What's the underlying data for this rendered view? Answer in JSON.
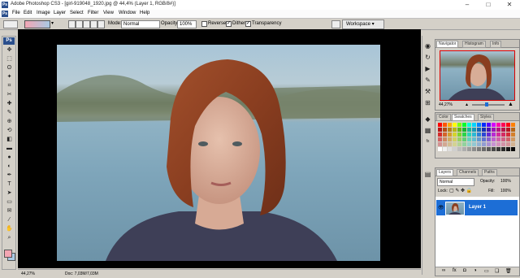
{
  "titlebar": {
    "app_icon": "Ps",
    "title": "Adobe Photoshop CS3 - [girl-919048_1920.jpg @ 44,4% (Layer 1, RGB/8#)]",
    "minimize": "–",
    "maximize": "□",
    "close": "✕"
  },
  "menubar": {
    "logo": "Ps",
    "items": [
      "File",
      "Edit",
      "Image",
      "Layer",
      "Select",
      "Filter",
      "View",
      "Window",
      "Help"
    ]
  },
  "options": {
    "mode_label": "Mode:",
    "mode_value": "Normal",
    "opacity_label": "Opacity:",
    "opacity_value": "100%",
    "reverse_label": "Reverse",
    "dither_label": "Dither",
    "transparency_label": "Transparency",
    "workspace_label": "Workspace ▾"
  },
  "toolbox": {
    "header": "Ps",
    "tools": [
      "move-icon",
      "marquee-icon",
      "lasso-icon",
      "magic-wand-icon",
      "crop-icon",
      "slice-icon",
      "healing-brush-icon",
      "brush-icon",
      "clone-stamp-icon",
      "history-brush-icon",
      "eraser-icon",
      "gradient-icon",
      "blur-icon",
      "dodge-icon",
      "pen-icon",
      "type-icon",
      "path-selection-icon",
      "rectangle-icon",
      "notes-icon",
      "eyedropper-icon",
      "hand-icon",
      "zoom-icon"
    ],
    "glyphs": [
      "✥",
      "⬚",
      "ʘ",
      "✦",
      "⌗",
      "✂",
      "✚",
      "✎",
      "⊕",
      "⟲",
      "◧",
      "▬",
      "●",
      "◐",
      "✒",
      "T",
      "➤",
      "▭",
      "✉",
      "⁄",
      "✋",
      "⌕"
    ],
    "fg_color": "#f3a6b3",
    "bg_color": "#a9c9e4"
  },
  "status": {
    "zoom": "44,27%",
    "doc": "Doc: 7,03M/7,03M"
  },
  "dock": {
    "icons": [
      "navigator-icon",
      "history-icon",
      "actions-icon",
      "brushes-icon",
      "tool-presets-icon",
      "layer-comps-icon",
      "color-icon",
      "swatches-icon",
      "styles-icon",
      "layers-icon"
    ],
    "glyphs": [
      "◉",
      "↻",
      "▶",
      "✎",
      "⚒",
      "⊞",
      "◆",
      "▦",
      "fx",
      "▤"
    ]
  },
  "navigator": {
    "tabs": [
      "Navigator",
      "Histogram",
      "Info"
    ],
    "zoom": "44,27%"
  },
  "swatches_panel": {
    "tabs": [
      "Color",
      "Swatches",
      "Styles"
    ]
  },
  "layers_panel": {
    "tabs": [
      "Layers",
      "Channels",
      "Paths"
    ],
    "blend_mode": "Normal",
    "opacity_label": "Opacity:",
    "opacity_value": "100%",
    "lock_label": "Lock:",
    "fill_label": "Fill:",
    "fill_value": "100%",
    "layer_name": "Layer 1",
    "footer_icons": [
      "link-icon",
      "fx-icon",
      "mask-icon",
      "adjustment-icon",
      "group-icon",
      "new-layer-icon",
      "trash-icon"
    ],
    "footer_glyphs": [
      "∞",
      "fx",
      "◘",
      "◑",
      "▭",
      "❑",
      "🗑"
    ]
  }
}
